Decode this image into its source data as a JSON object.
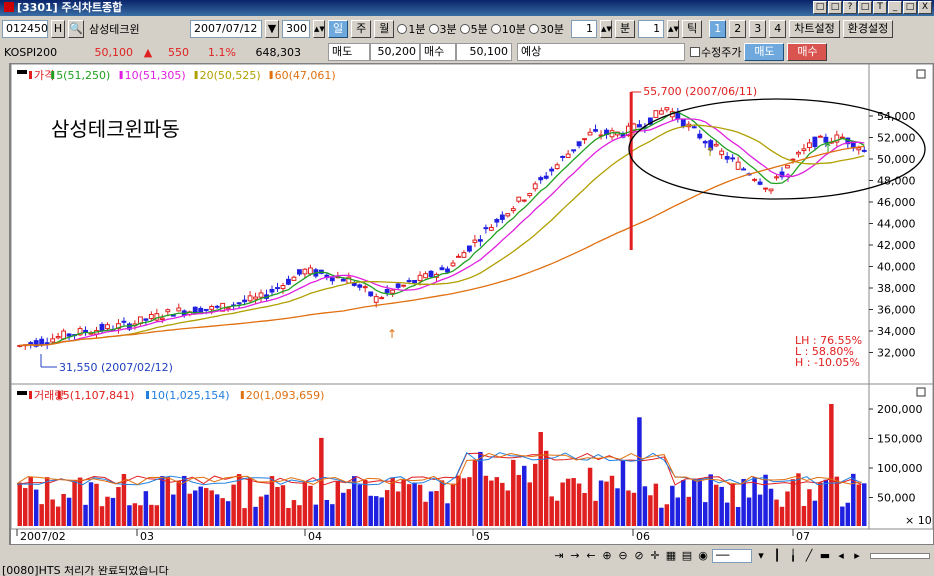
{
  "window": {
    "title": "[3301] 주식차트종합",
    "buttons": [
      "□",
      "□",
      "?",
      "□",
      "T",
      "_",
      "□",
      "X"
    ]
  },
  "toolbar": {
    "code": "012450",
    "code_btn": "H",
    "name": "삼성테크윈",
    "date": "2007/07/12",
    "count": "300",
    "period_tabs": [
      "일",
      "주",
      "월"
    ],
    "minute_options": [
      "1분",
      "3분",
      "5분",
      "10분",
      "30분"
    ],
    "unit_value1": "1",
    "unit_label1": "분",
    "unit_value2": "1",
    "unit_label2": "틱",
    "page_tabs": [
      "1",
      "2",
      "3",
      "4"
    ],
    "chart_settings": "차트설정",
    "env_settings": "환경설정"
  },
  "quote": {
    "index_name": "KOSPI200",
    "price": "50,100",
    "change_arrow": "▲",
    "change": "550",
    "change_pct": "1.1%",
    "volume": "648,303",
    "ask_label": "매도",
    "ask": "50,200",
    "bid_label": "매수",
    "bid": "50,100",
    "forecast_label": "예상",
    "revise_label": "수정주가",
    "sell_btn": "매도",
    "buy_btn": "매수"
  },
  "colors": {
    "up": "#e02020",
    "down": "#2020e0",
    "ma5": "#20a020",
    "ma10": "#e020e0",
    "ma20": "#b0a000",
    "ma60": "#e07010"
  },
  "price_panel": {
    "legend": [
      {
        "label": "가격",
        "color": "#e02020"
      },
      {
        "label": "5(51,250)",
        "color": "#20a020"
      },
      {
        "label": "10(51,305)",
        "color": "#e020e0"
      },
      {
        "label": "20(50,525)",
        "color": "#b0a000"
      },
      {
        "label": "60(47,061)",
        "color": "#e07010"
      }
    ],
    "annotation": "삼성테크윈파동",
    "high_label": "55,700 (2007/06/11)",
    "low_label": "31,550 (2007/02/12)",
    "stats": [
      "LH :  76.55%",
      "L  :  58.80%",
      "H  : -10.05%"
    ],
    "y_ticks": [
      "54,000",
      "52,000",
      "50,000",
      "48,000",
      "46,000",
      "44,000",
      "42,000",
      "40,000",
      "38,000",
      "36,000",
      "34,000",
      "32,000"
    ]
  },
  "volume_panel": {
    "legend": [
      {
        "label": "거래량",
        "color": "#e02020"
      },
      {
        "label": "5(1,107,841)",
        "color": "#e02020"
      },
      {
        "label": "10(1,025,154)",
        "color": "#2080e0"
      },
      {
        "label": "20(1,093,659)",
        "color": "#e07010"
      }
    ],
    "y_ticks": [
      "200,000",
      "150,000",
      "100,000",
      "50,000"
    ],
    "unit": "× 10"
  },
  "x_axis": [
    "2007/02",
    "03",
    "04",
    "05",
    "06",
    "07"
  ],
  "status_text": "[0080]HTS 처리가 완료되었습니다"
}
